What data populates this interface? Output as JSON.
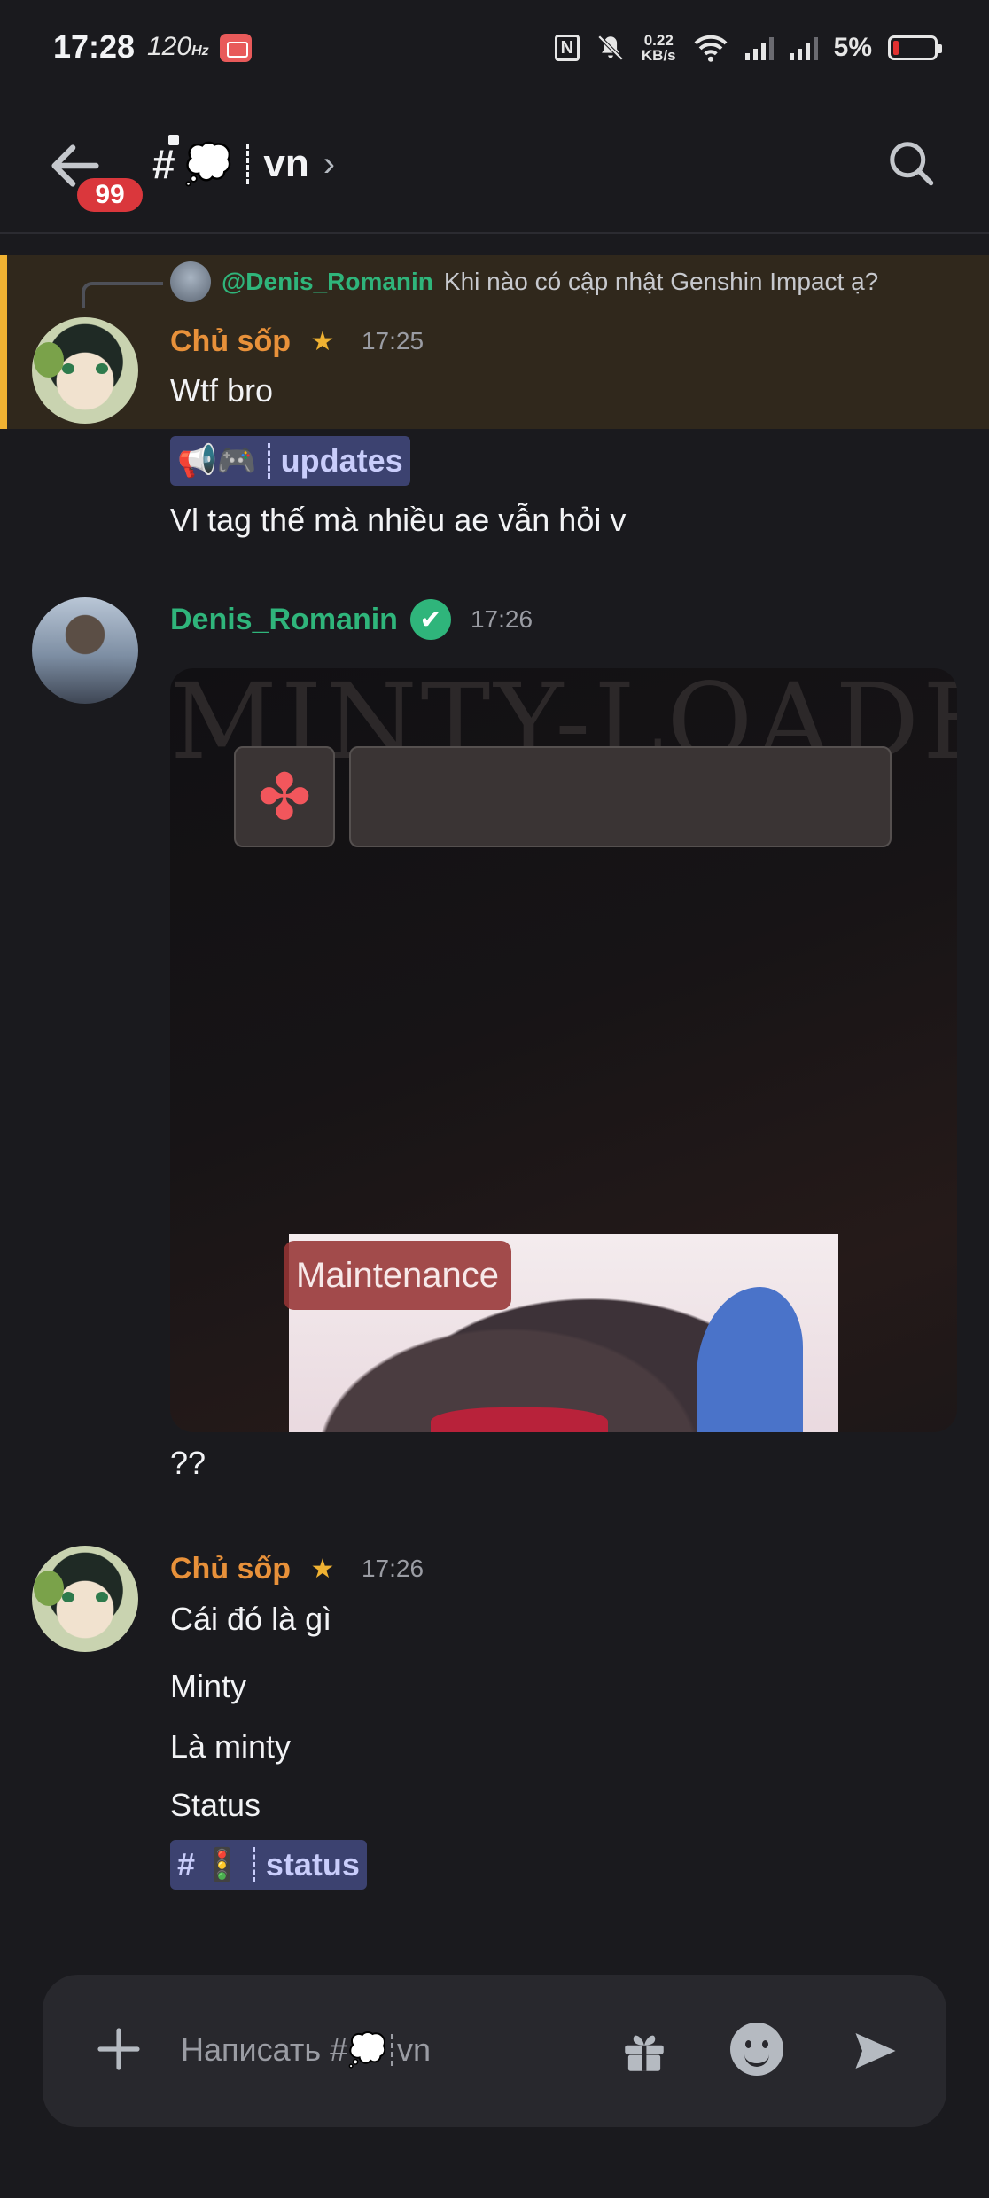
{
  "status_bar": {
    "time": "17:28",
    "refresh_rate": "120",
    "refresh_unit": "Hz",
    "net_speed_value": "0.22",
    "net_speed_unit": "KB/s",
    "nfc_label": "N",
    "battery_percent": "5%"
  },
  "header": {
    "unread_count": "99",
    "channel_hash": "#",
    "channel_emoji": "💭",
    "channel_name": "vn",
    "chevron": "›"
  },
  "messages": {
    "reply": {
      "name": "@Denis_Romanin",
      "text": "Khi nào có cập nhật Genshin Impact ạ?"
    },
    "group1": {
      "author": "Chủ sốp",
      "role_badge": "★",
      "time": "17:25",
      "lines": [
        "Wtf bro",
        "Vl tag thế mà nhiều ae vẫn hỏi v"
      ],
      "channel_chip": {
        "icons": "📢🎮",
        "name": "updates"
      }
    },
    "group2": {
      "author": "Denis_Romanin",
      "verified": "✔",
      "time": "17:26",
      "embed": {
        "watermark": "MINTY-LOADER",
        "clover": "✤",
        "badge": "Maintenance"
      },
      "text": "??"
    },
    "group3": {
      "author": "Chủ sốp",
      "role_badge": "★",
      "time": "17:26",
      "lines": [
        "Cái đó là gì",
        "Minty",
        "Là minty",
        "Status"
      ],
      "channel_chip": {
        "hash": "#",
        "icon": "🚦",
        "name": "status"
      }
    }
  },
  "composer": {
    "placeholder_prefix": "Написать #",
    "placeholder_emoji": "💭",
    "placeholder_channel": "vn"
  },
  "colors": {
    "background": "#1a1a1e",
    "mention_highlight": "#30281c",
    "mention_bar": "#f0b232",
    "owner_name": "#e8913a",
    "member_name": "#2fb57b",
    "channel_chip": "#3c4270",
    "unread_badge": "#da373c"
  },
  "icons": {
    "back": "arrow-left-icon",
    "search": "search-icon",
    "plus": "plus-icon",
    "gift": "gift-icon",
    "emoji": "emoji-icon",
    "send": "send-icon"
  }
}
